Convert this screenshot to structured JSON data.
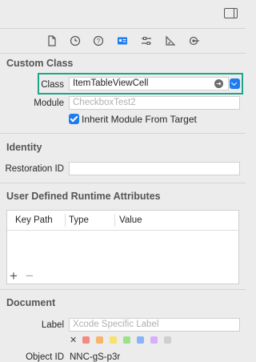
{
  "header": {
    "panel_toggle_icon": "sidebar-toggle-icon"
  },
  "tabs": [
    {
      "icon": "file-icon"
    },
    {
      "icon": "history-clock-icon"
    },
    {
      "icon": "help-icon"
    },
    {
      "icon": "identity-card-icon",
      "selected": true
    },
    {
      "icon": "attributes-sliders-icon"
    },
    {
      "icon": "size-ruler-icon"
    },
    {
      "icon": "connections-icon"
    }
  ],
  "custom_class": {
    "title": "Custom Class",
    "class_label": "Class",
    "class_value": "ItemTableViewCell",
    "module_label": "Module",
    "module_placeholder": "CheckboxTest2",
    "inherit_label": "Inherit Module From Target",
    "inherit_checked": true
  },
  "identity": {
    "title": "Identity",
    "restoration_label": "Restoration ID",
    "restoration_value": ""
  },
  "runtime_attributes": {
    "title": "User Defined Runtime Attributes",
    "columns": [
      "Key Path",
      "Type",
      "Value"
    ],
    "rows": [],
    "add_symbol": "+",
    "remove_symbol": "−"
  },
  "document": {
    "title": "Document",
    "label_label": "Label",
    "label_placeholder": "Xcode Specific Label",
    "clear_symbol": "✕",
    "swatch_colors": [
      "#f28b82",
      "#fbb36b",
      "#f7e26b",
      "#9be28b",
      "#8ab4f8",
      "#d7aefb",
      "#cfcfcf"
    ],
    "object_id_label": "Object ID",
    "object_id_value": "NNC-gS-p3r"
  },
  "colors": {
    "accent": "#1d7cf2",
    "highlight": "#1fa58a"
  }
}
